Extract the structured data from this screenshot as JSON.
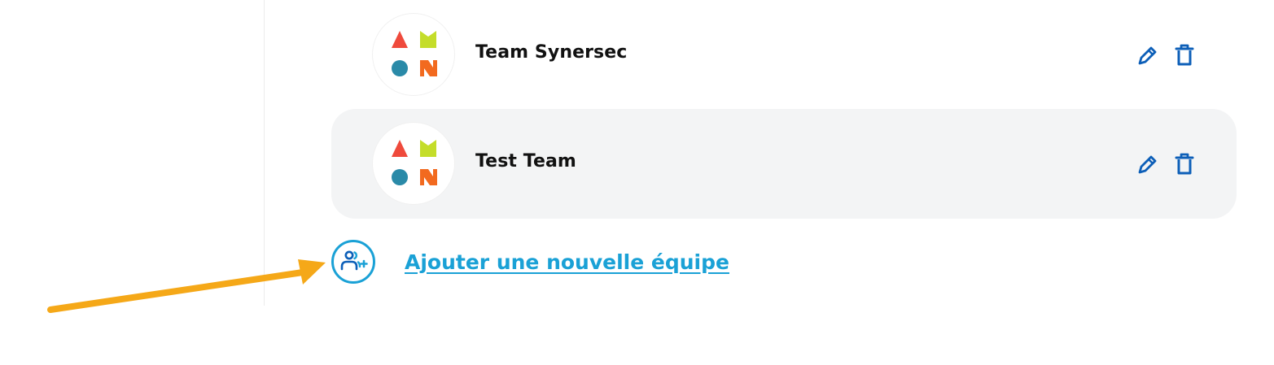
{
  "teams": [
    {
      "name": "Team Synersec",
      "avatar_icon": "team-logo-icon"
    },
    {
      "name": "Test Team",
      "avatar_icon": "team-logo-icon"
    }
  ],
  "actions": {
    "edit_icon": "pencil-icon",
    "delete_icon": "trash-icon"
  },
  "add_team": {
    "label": "Ajouter une nouvelle équipe",
    "icon": "add-users-icon"
  },
  "annotation": {
    "icon": "arrow-icon",
    "color": "#f5a818"
  },
  "colors": {
    "accent": "#1aa1d6",
    "action_icon": "#0d5fb8",
    "row_highlight": "#f3f4f5",
    "logo_red": "#ef4a3c",
    "logo_green": "#c4dd2a",
    "logo_blue": "#2a8aa8",
    "logo_orange": "#f26a1f"
  }
}
